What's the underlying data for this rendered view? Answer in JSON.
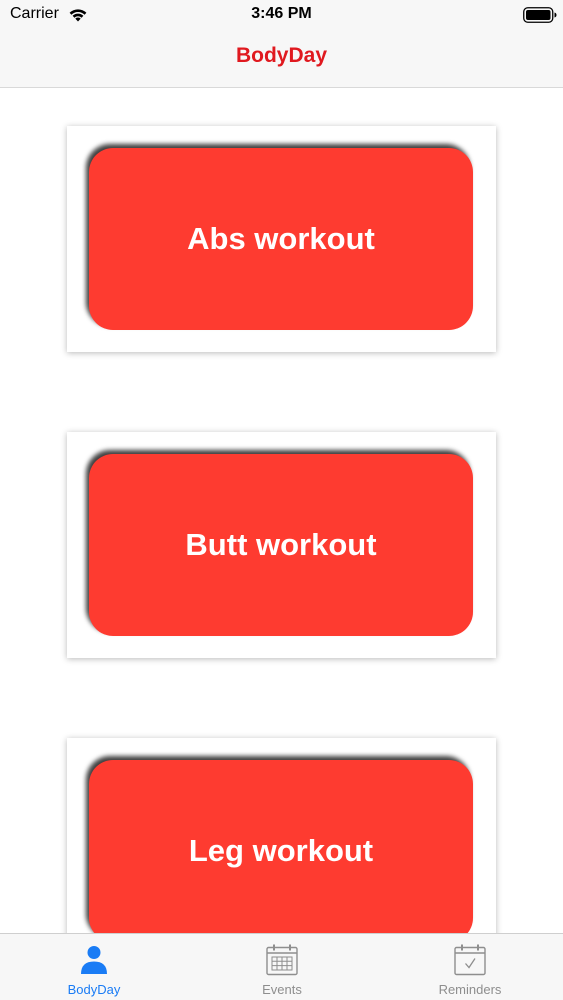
{
  "status_bar": {
    "carrier": "Carrier",
    "time": "3:46 PM",
    "icons": [
      "wifi-icon",
      "battery-icon"
    ]
  },
  "nav": {
    "title": "BodyDay",
    "title_color": "#e0191f"
  },
  "workouts": [
    {
      "label": "Abs workout"
    },
    {
      "label": "Butt workout"
    },
    {
      "label": "Leg workout"
    }
  ],
  "button_color": "#fe3b30",
  "tabbar": {
    "selected_index": 0,
    "active_color": "#1a7cf5",
    "inactive_color": "#8e8e8e",
    "tabs": [
      {
        "label": "BodyDay",
        "icon": "person-icon"
      },
      {
        "label": "Events",
        "icon": "calendar-grid-icon"
      },
      {
        "label": "Reminders",
        "icon": "calendar-check-icon"
      }
    ]
  }
}
